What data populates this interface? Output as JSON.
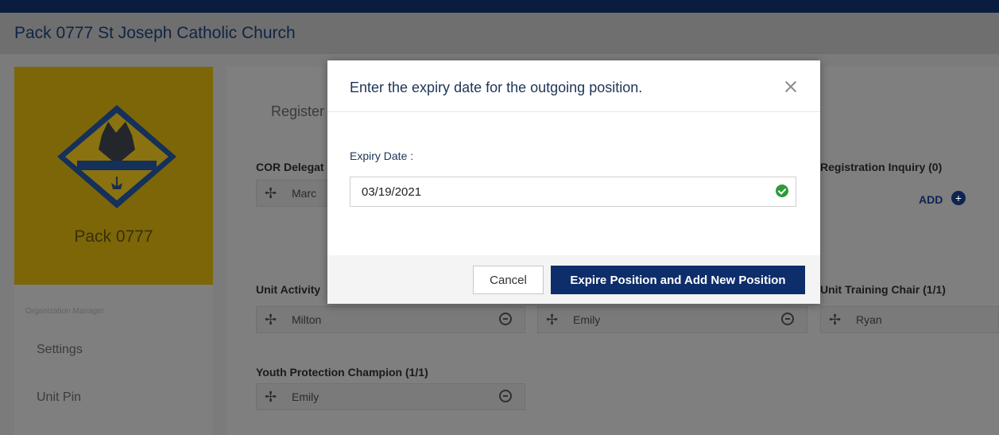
{
  "header": {
    "title": "Pack 0777 St Joseph Catholic Church"
  },
  "left_panel": {
    "pack_name": "Pack 0777",
    "organization_manager": "Organization Manager",
    "menu": [
      "Settings",
      "Unit Pin"
    ]
  },
  "content": {
    "tab": "Register",
    "groups": [
      {
        "label": "COR Delegat",
        "name": "Marc"
      },
      {
        "label": "Unit Activity",
        "name": "Milton"
      },
      {
        "label": "Youth Protection Champion (1/1)",
        "name": "Emily"
      }
    ],
    "right_groups": [
      {
        "label": "Registration Inquiry (0)",
        "action": "ADD"
      },
      {
        "label": "Unit Training Chair (1/1)",
        "name": "Ryan"
      }
    ],
    "middle_name": "Emily"
  },
  "modal": {
    "title": "Enter the expiry date for the outgoing position.",
    "field_label": "Expiry Date :",
    "date_value": "03/19/2021",
    "cancel_label": "Cancel",
    "submit_label": "Expire Position and Add New Position"
  },
  "colors": {
    "navy": "#0e2d6b",
    "success": "#2e9b3b"
  }
}
